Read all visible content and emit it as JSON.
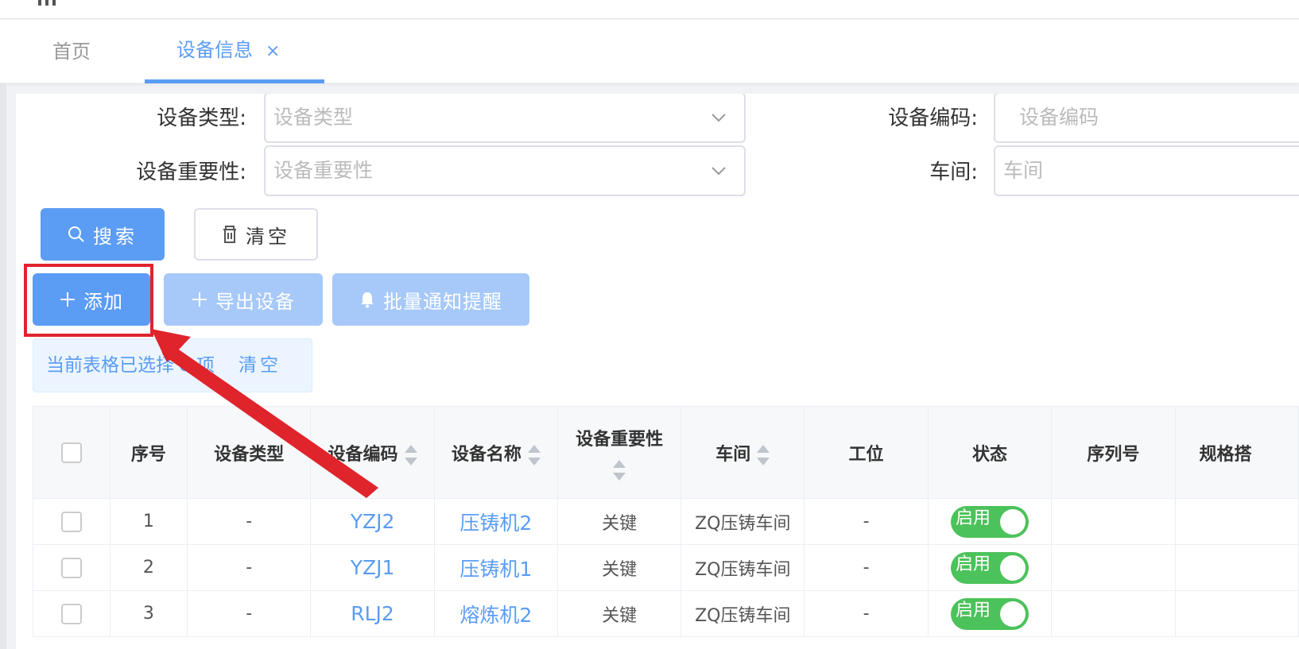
{
  "tabs": {
    "home": "首页",
    "active": "设备信息",
    "close": "×"
  },
  "filters": {
    "type": {
      "label": "设备类型:",
      "placeholder": "设备类型"
    },
    "code": {
      "label": "设备编码:",
      "placeholder": "设备编码"
    },
    "importance": {
      "label": "设备重要性:",
      "placeholder": "设备重要性"
    },
    "workshop": {
      "label": "车间:",
      "placeholder": "车间"
    }
  },
  "buttons": {
    "search": "搜索",
    "clear": "清空",
    "add": "添加",
    "export": "导出设备",
    "notify": "批量通知提醒"
  },
  "selection": {
    "prefix": "当前表格已选择",
    "count": "0",
    "suffix": "项",
    "clear": "清空"
  },
  "table": {
    "headers": [
      "序号",
      "设备类型",
      "设备编码",
      "设备名称",
      "设备重要性",
      "车间",
      "工位",
      "状态",
      "序列号",
      "规格搭"
    ],
    "rows": [
      {
        "index": "1",
        "type": "-",
        "code": "YZJ2",
        "name": "压铸机2",
        "importance": "关键",
        "workshop": "ZQ压铸车间",
        "station": "-",
        "status": "启用"
      },
      {
        "index": "2",
        "type": "-",
        "code": "YZJ1",
        "name": "压铸机1",
        "importance": "关键",
        "workshop": "ZQ压铸车间",
        "station": "-",
        "status": "启用"
      },
      {
        "index": "3",
        "type": "-",
        "code": "RLJ2",
        "name": "熔炼机2",
        "importance": "关键",
        "workshop": "ZQ压铸车间",
        "station": "-",
        "status": "启用"
      }
    ]
  },
  "colors": {
    "primary": "#5b9cf5",
    "primary_light": "#a7c9f9",
    "switch_on": "#4cc25a",
    "highlight": "#e0242c"
  }
}
